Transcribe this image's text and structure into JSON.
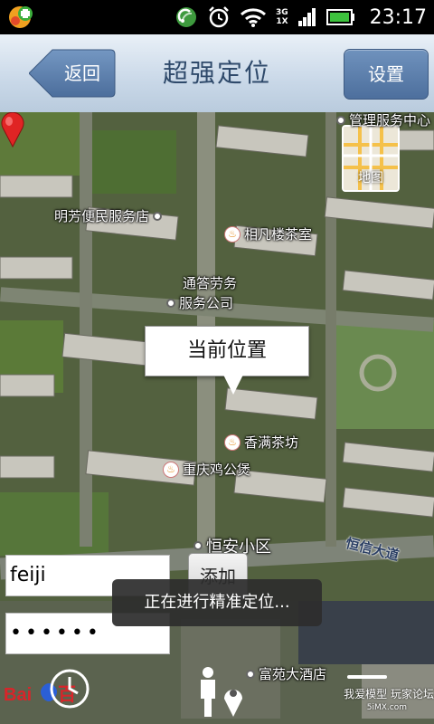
{
  "status_bar": {
    "time": "23:17",
    "network_top": "3G",
    "network_bottom": "1X",
    "icons": [
      "app-plus-icon",
      "sync-icon",
      "alarm-clock-icon",
      "wifi-icon",
      "signal-icon",
      "battery-icon"
    ]
  },
  "header": {
    "title": "超强定位",
    "back_label": "返回",
    "settings_label": "设置"
  },
  "map": {
    "toggle_label": "地图",
    "current_location_label": "当前位置",
    "pois": [
      {
        "name": "明芳便民服务店",
        "kind": "dot"
      },
      {
        "name": "相凡楼茶室",
        "kind": "food"
      },
      {
        "name": "通答劳务",
        "kind": "dot"
      },
      {
        "name": "服务公司",
        "kind": "text"
      },
      {
        "name": "香满茶坊",
        "kind": "food"
      },
      {
        "name": "重庆鸡公煲",
        "kind": "food"
      },
      {
        "name": "恒安小区",
        "kind": "dot"
      },
      {
        "name": "富苑大酒店",
        "kind": "dot"
      },
      {
        "name": "管理服务中心",
        "kind": "dot"
      }
    ],
    "road_label": "恒信大道"
  },
  "form": {
    "username_value": "feiji",
    "password_value": "••••••",
    "add_label": "添加"
  },
  "toast": {
    "text": "正在进行精准定位..."
  },
  "watermark": {
    "line1": "我爱模型 玩家论坛",
    "line2": "5iMX.com"
  },
  "colors": {
    "title_text": "#2f4a6b",
    "button_blue": "#5a7eae",
    "pin_red": "#e02424"
  }
}
